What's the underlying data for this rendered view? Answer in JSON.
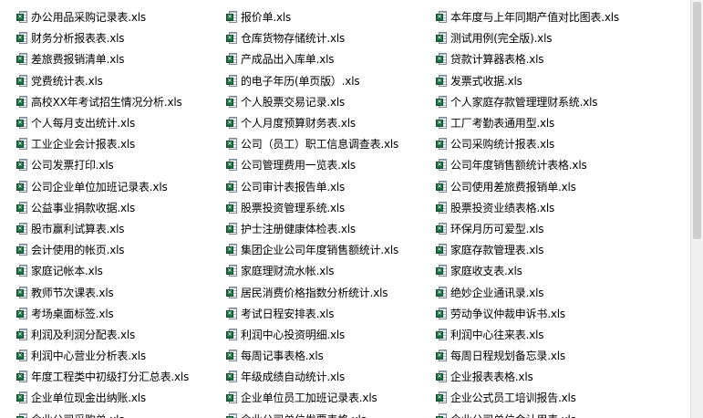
{
  "file_list": {
    "columns": [
      [
        "办公用品采购记录表.xls",
        "财务分析报表表.xls",
        "差旅费报销清单.xls",
        "党费统计表.xls",
        "高校XX年考试招生情况分析.xls",
        "个人每月支出统计.xls",
        "工业企业会计报表.xls",
        "公司发票打印.xls",
        "公司企业单位加班记录表.xls",
        "公益事业捐款收据.xls",
        "股市赢利试算表.xls",
        "会计使用的帐页.xls",
        "家庭记帐本.xls",
        "教师节次课表.xls",
        "考场桌面标签.xls",
        "利润及利润分配表.xls",
        "利润中心营业分析表.xls",
        "年度工程类中初级打分汇总表.xls",
        "企业单位现金出纳账.xls",
        "企业公司采购单.xls"
      ],
      [
        "报价单.xls",
        "仓库货物存储统计.xls",
        "产成品出入库单.xls",
        "的电子年历(单页版）.xls",
        "个人股票交易记录.xls",
        "个人月度预算财务表.xls",
        "公司（员工）职工信息调查表.xls",
        "公司管理费用一览表.xls",
        "公司审计表报告单.xls",
        "股票投资管理系统.xls",
        "护士注册健康体检表.xls",
        "集团企业公司年度销售额统计.xls",
        "家庭理财流水帐.xls",
        "居民消费价格指数分析统计.xls",
        "考试日程安排表.xls",
        "利润中心投资明细.xls",
        "每周记事表格.xls",
        "年级成绩自动统计.xls",
        "企业单位员工加班记录表.xls",
        "企业公司单位发票表格.xls"
      ],
      [
        "本年度与上年同期产值对比图表.xls",
        "测试用例(完全版).xls",
        "贷款计算器表格.xls",
        "发票式收据.xls",
        "个人家庭存款管理理财系统.xls",
        "工厂考勤表通用型.xls",
        "公司采购统计报表.xls",
        "公司年度销售额统计表格.xls",
        "公司使用差旅费报销单.xls",
        "股票投资业绩表格.xls",
        "环保月历可爱型.xls",
        "家庭存款管理表.xls",
        "家庭收支表.xls",
        "绝妙企业通讯录.xls",
        "劳动争议仲裁申诉书.xls",
        "利润中心往来表.xls",
        "每周日程规划备忘录.xls",
        "企业报表表格.xls",
        "企业公式员工培训报告.xls",
        "企业公司单位会计用表.xls"
      ]
    ],
    "icon": "excel-file-icon"
  }
}
